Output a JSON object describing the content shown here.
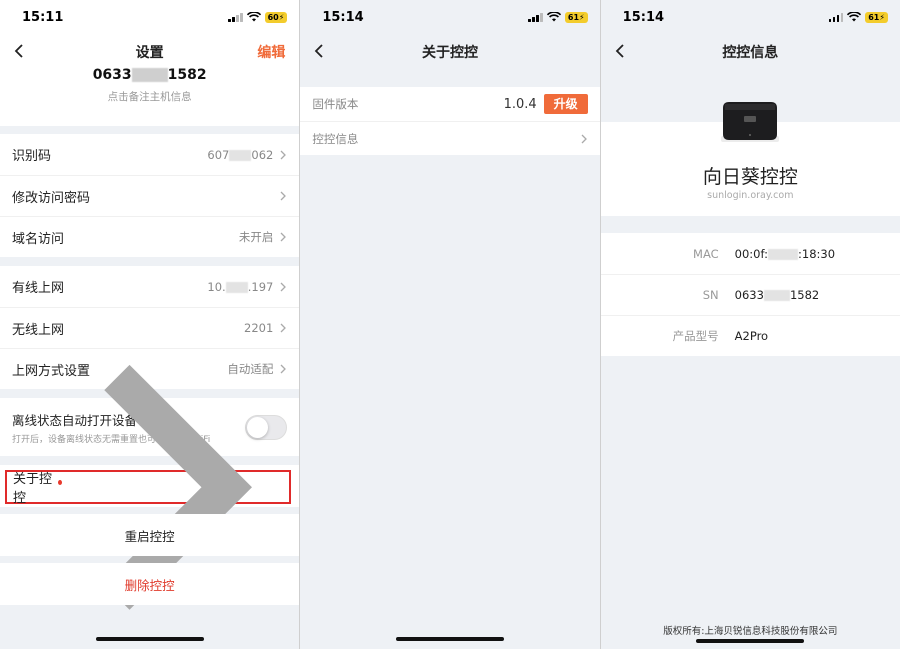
{
  "status": {
    "time1": "15:11",
    "battery1": "60",
    "time2": "15:14",
    "battery2": "61",
    "time3": "15:14",
    "battery3": "61"
  },
  "screen1": {
    "title": "设置",
    "edit_label": "编辑",
    "host_prefix": "0633",
    "host_suffix": "1582",
    "host_hint": "点击备注主机信息",
    "group1": [
      {
        "label": "识别码",
        "value_prefix": "607",
        "value_suffix": "062"
      },
      {
        "label": "修改访问密码",
        "value": ""
      },
      {
        "label": "域名访问",
        "value": "未开启"
      }
    ],
    "group2": [
      {
        "label": "有线上网",
        "value_prefix": "10.",
        "value_suffix": ".197"
      },
      {
        "label": "无线上网",
        "value": "2201"
      },
      {
        "label": "上网方式设置",
        "value": "自动适配"
      }
    ],
    "wifi_title": "离线状态自动打开设备 Wifi",
    "wifi_desc": "打开后，设备离线状态无需重置也可设置上网WiFi",
    "wifi_enabled": false,
    "about_label": "关于控控",
    "restart_label": "重启控控",
    "delete_label": "删除控控"
  },
  "screen2": {
    "title": "关于控控",
    "firmware_label": "固件版本",
    "firmware_version": "1.0.4",
    "upgrade_label": "升级",
    "info_label": "控控信息"
  },
  "screen3": {
    "title": "控控信息",
    "product_name": "向日葵控控",
    "product_url": "sunlogin.oray.com",
    "rows": [
      {
        "key": "MAC",
        "value_prefix": "00:0f:",
        "value_suffix": ":18:30"
      },
      {
        "key": "SN",
        "value_prefix": "0633",
        "value_suffix": "1582"
      },
      {
        "key": "产品型号",
        "value": "A2Pro"
      }
    ],
    "copyright": "版权所有:上海贝锐信息科技股份有限公司"
  },
  "colors": {
    "accent": "#f06b3a",
    "danger": "#e03a2b",
    "badge": "#e8392c"
  }
}
